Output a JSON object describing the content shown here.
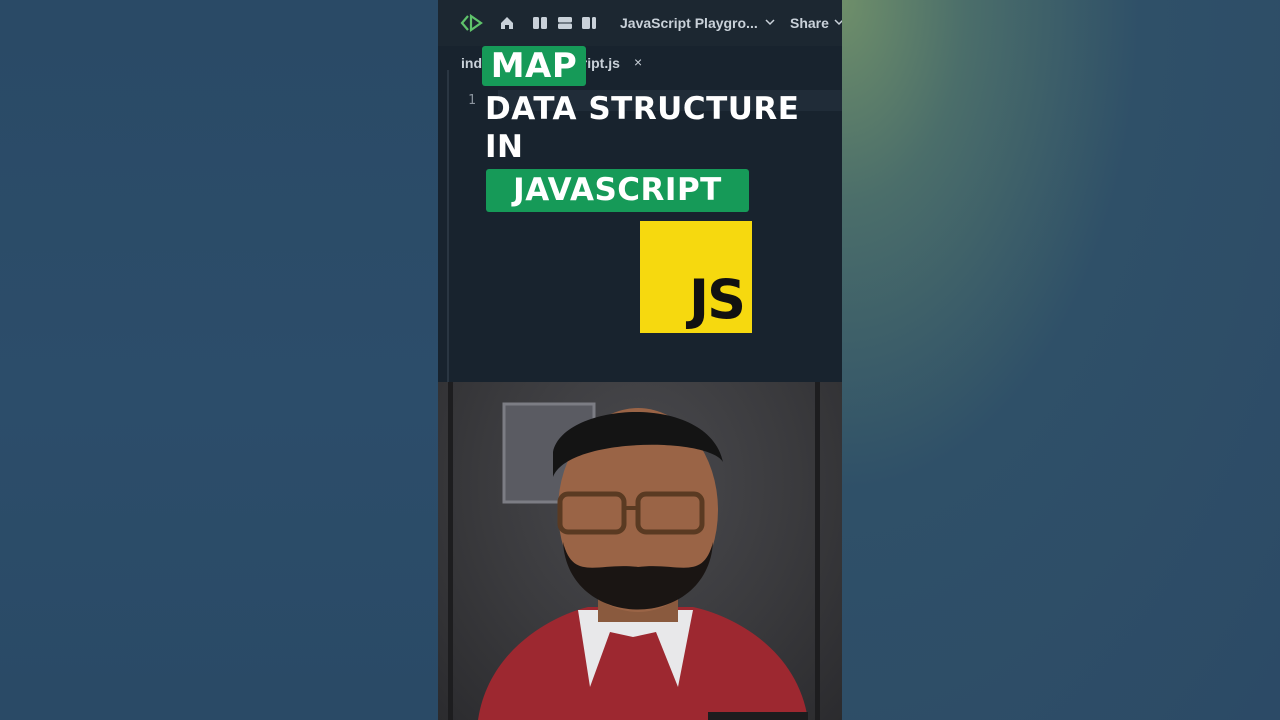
{
  "toolbar": {
    "project_title": "JavaScript Playgro...",
    "share_label": "Share"
  },
  "tabs": {
    "file_tab_prefix": "inde",
    "file_tab_suffix": "ript.js",
    "close_glyph": "×"
  },
  "editor": {
    "line_number": "1"
  },
  "overlay": {
    "word1": "MAP",
    "line2": "DATA STRUCTURE",
    "line3": "IN",
    "line4": "JAVASCRIPT",
    "logo_text": "JS"
  },
  "colors": {
    "accent_green": "#169a58",
    "js_yellow": "#f6d90f",
    "editor_bg": "#18232e"
  }
}
